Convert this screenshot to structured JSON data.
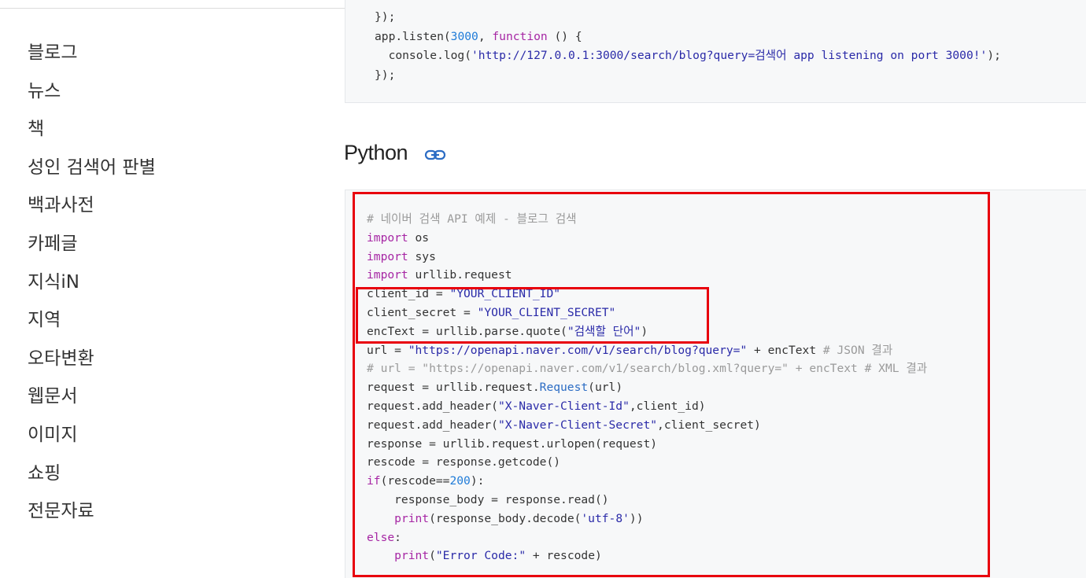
{
  "sidebar": {
    "items": [
      {
        "label": "블로그"
      },
      {
        "label": "뉴스"
      },
      {
        "label": "책"
      },
      {
        "label": "성인 검색어 판별"
      },
      {
        "label": "백과사전"
      },
      {
        "label": "카페글"
      },
      {
        "label": "지식iN"
      },
      {
        "label": "지역"
      },
      {
        "label": "오타변환"
      },
      {
        "label": "웹문서"
      },
      {
        "label": "이미지"
      },
      {
        "label": "쇼핑"
      },
      {
        "label": "전문자료"
      }
    ]
  },
  "node_code": {
    "line1": "});",
    "line2_pre": "app.listen(",
    "line2_num": "3000",
    "line2_mid": ", ",
    "line2_kw": "function",
    "line2_post": " () {",
    "line3_pre": "  console.log(",
    "line3_str": "'http://127.0.0.1:3000/search/blog?query=검색어 app listening on port 3000!'",
    "line3_post": ");",
    "line4": "});"
  },
  "section": {
    "title": "Python",
    "link_icon": "link-icon"
  },
  "python_code": {
    "l1": "# 네이버 검색 API 예제 - 블로그 검색",
    "l2_kw": "import",
    "l2_rest": " os",
    "l3_kw": "import",
    "l3_rest": " sys",
    "l4_kw": "import",
    "l4_rest": " urllib.request",
    "l5_pre": "client_id = ",
    "l5_str": "\"YOUR_CLIENT_ID\"",
    "l6_pre": "client_secret = ",
    "l6_str": "\"YOUR_CLIENT_SECRET\"",
    "l7_pre": "encText = urllib.parse.quote(",
    "l7_str": "\"검색할 단어\"",
    "l7_post": ")",
    "l8_pre": "url = ",
    "l8_str": "\"https://openapi.naver.com/v1/search/blog?query=\"",
    "l8_mid": " + encText ",
    "l8_cm": "# JSON 결과",
    "l9": "# url = \"https://openapi.naver.com/v1/search/blog.xml?query=\" + encText # XML 결과",
    "l10_pre": "request = urllib.request.",
    "l10_fn": "Request",
    "l10_post": "(url)",
    "l11_pre": "request.add_header(",
    "l11_str": "\"X-Naver-Client-Id\"",
    "l11_post": ",client_id)",
    "l12_pre": "request.add_header(",
    "l12_str": "\"X-Naver-Client-Secret\"",
    "l12_post": ",client_secret)",
    "l13": "response = urllib.request.urlopen(request)",
    "l14": "rescode = response.getcode()",
    "l15_kw": "if",
    "l15_pre": "(rescode==",
    "l15_num": "200",
    "l15_post": "):",
    "l16": "    response_body = response.read()",
    "l17_indent": "    ",
    "l17_kw": "print",
    "l17_pre": "(response_body.decode(",
    "l17_str": "'utf-8'",
    "l17_post": "))",
    "l18_kw": "else",
    "l18_post": ":",
    "l19_indent": "    ",
    "l19_kw": "print",
    "l19_pre": "(",
    "l19_str": "\"Error Code:\"",
    "l19_post": " + rescode)"
  },
  "colors": {
    "highlight": "#e8000d",
    "keyword": "#a626a4",
    "string": "#2a2aa8",
    "number": "#1f7bd8",
    "comment": "#9a9a9a"
  }
}
